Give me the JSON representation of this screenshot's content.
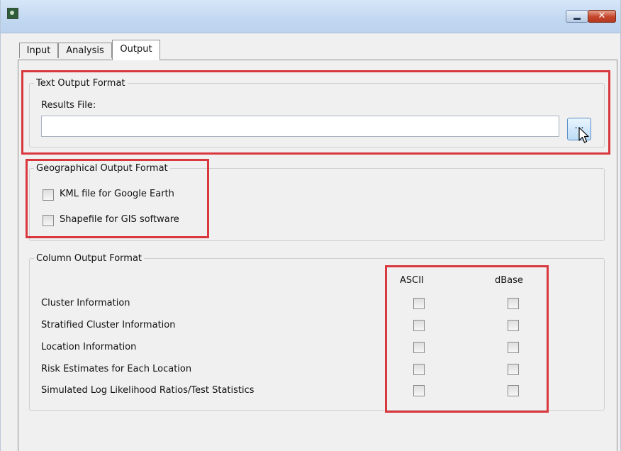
{
  "window": {
    "app_icon": "app-icon",
    "close_glyph": "✕"
  },
  "tabs": [
    {
      "label": "Input",
      "active": false
    },
    {
      "label": "Analysis",
      "active": false
    },
    {
      "label": "Output",
      "active": true
    }
  ],
  "text_output": {
    "legend": "Text Output Format",
    "results_label": "Results File:",
    "results_value": "",
    "browse_label": "..."
  },
  "geo_output": {
    "legend": "Geographical Output Format",
    "options": [
      {
        "label": "KML file for Google Earth",
        "checked": false
      },
      {
        "label": "Shapefile for GIS software",
        "checked": false
      }
    ]
  },
  "column_output": {
    "legend": "Column Output Format",
    "col_ascii": "ASCII",
    "col_dbase": "dBase",
    "rows": [
      {
        "label": "Cluster Information",
        "ascii": false,
        "dbase": false
      },
      {
        "label": "Stratified Cluster Information",
        "ascii": false,
        "dbase": false
      },
      {
        "label": "Location Information",
        "ascii": false,
        "dbase": false
      },
      {
        "label": "Risk Estimates for Each Location",
        "ascii": false,
        "dbase": false
      },
      {
        "label": "Simulated Log Likelihood Ratios/Test Statistics",
        "ascii": false,
        "dbase": false
      }
    ]
  },
  "colors": {
    "highlight": "#d9383f",
    "titlebar": "#c2d8f1"
  }
}
